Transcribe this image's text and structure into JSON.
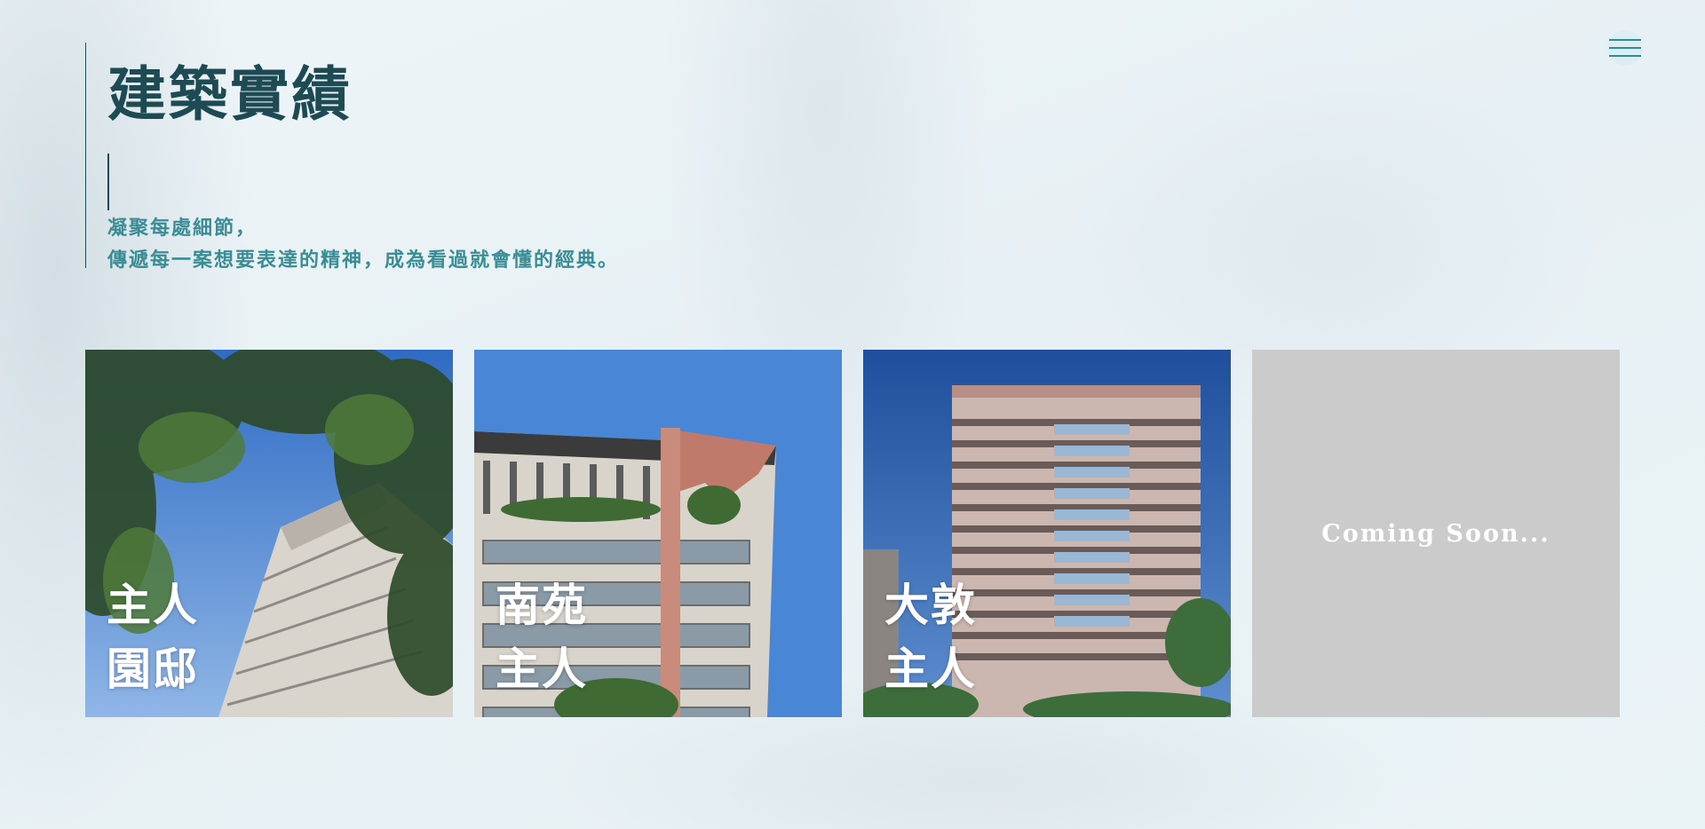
{
  "nav": {
    "menu_icon": "hamburger-menu-icon"
  },
  "header": {
    "title": "建築實績",
    "subtitle_lines": [
      "凝聚每處細節，",
      "傳遞每一案想要表達的精神，成為看過就會懂的經典。"
    ]
  },
  "projects": [
    {
      "title_lines": [
        "主人",
        "園邸"
      ]
    },
    {
      "title_lines": [
        "南苑",
        "主人"
      ]
    },
    {
      "title_lines": [
        "大敦",
        "主人"
      ]
    },
    {
      "coming_soon_text": "Coming Soon..."
    }
  ],
  "colors": {
    "title": "#1d4a53",
    "subtitle": "#3a8c95",
    "accent": "#2e8c96",
    "placeholder_card": "#cbcbcb"
  }
}
